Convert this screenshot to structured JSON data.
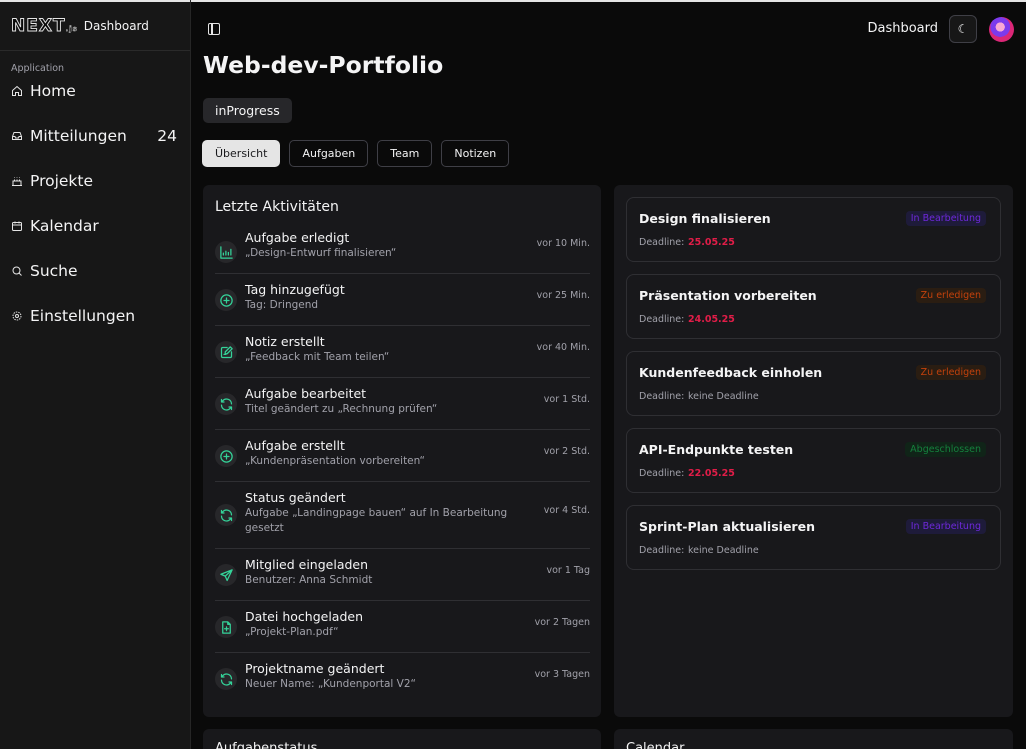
{
  "sidebar": {
    "brand_label": "Dashboard",
    "logo_text": "NEXT",
    "logo_suffix": ".js",
    "group_label": "Application",
    "items": [
      {
        "label": "Home",
        "icon": "home-icon"
      },
      {
        "label": "Mitteilungen",
        "icon": "inbox-icon",
        "count": "24"
      },
      {
        "label": "Projekte",
        "icon": "cake-icon"
      },
      {
        "label": "Kalendar",
        "icon": "calendar-icon"
      },
      {
        "label": "Suche",
        "icon": "search-icon"
      },
      {
        "label": "Einstellungen",
        "icon": "gear-icon"
      }
    ]
  },
  "header": {
    "title": "Dashboard",
    "theme_icon": "moon-icon"
  },
  "project": {
    "title": "Web-dev-Portfolio",
    "status": "inProgress"
  },
  "tabs": [
    {
      "label": "Übersicht",
      "active": true
    },
    {
      "label": "Aufgaben",
      "active": false
    },
    {
      "label": "Team",
      "active": false
    },
    {
      "label": "Notizen",
      "active": false
    }
  ],
  "activity": {
    "heading": "Letzte Aktivitäten",
    "items": [
      {
        "title": "Aufgabe erledigt",
        "desc": "„Design-Entwurf finalisieren“",
        "time": "vor 10 Min.",
        "icon": "chart-icon"
      },
      {
        "title": "Tag hinzugefügt",
        "desc": "Tag: Dringend",
        "time": "vor 25 Min.",
        "icon": "plus-circle-icon"
      },
      {
        "title": "Notiz erstellt",
        "desc": "„Feedback mit Team teilen“",
        "time": "vor 40 Min.",
        "icon": "note-edit-icon"
      },
      {
        "title": "Aufgabe bearbeitet",
        "desc": "Titel geändert zu „Rechnung prüfen“",
        "time": "vor 1 Std.",
        "icon": "refresh-icon"
      },
      {
        "title": "Aufgabe erstellt",
        "desc": "„Kundenpräsentation vorbereiten“",
        "time": "vor 2 Std.",
        "icon": "plus-circle-icon"
      },
      {
        "title": "Status geändert",
        "desc": "Aufgabe „Landingpage bauen“ auf In Bearbeitung gesetzt",
        "time": "vor 4 Std.",
        "icon": "refresh-icon"
      },
      {
        "title": "Mitglied eingeladen",
        "desc": "Benutzer: Anna Schmidt",
        "time": "vor 1 Tag",
        "icon": "send-icon"
      },
      {
        "title": "Datei hochgeladen",
        "desc": "„Projekt-Plan.pdf“",
        "time": "vor 2 Tagen",
        "icon": "file-plus-icon"
      },
      {
        "title": "Projektname geändert",
        "desc": "Neuer Name: „Kundenportal V2“",
        "time": "vor 3 Tagen",
        "icon": "refresh-icon"
      }
    ]
  },
  "tasks": {
    "deadline_label": "Deadline:",
    "items": [
      {
        "title": "Design finalisieren",
        "status": "In Bearbeitung",
        "status_type": "progress",
        "deadline": "25.05.25"
      },
      {
        "title": "Präsentation vorbereiten",
        "status": "Zu erledigen",
        "status_type": "todo",
        "deadline": "24.05.25"
      },
      {
        "title": "Kundenfeedback einholen",
        "status": "Zu erledigen",
        "status_type": "todo",
        "deadline": "keine Deadline"
      },
      {
        "title": "API-Endpunkte testen",
        "status": "Abgeschlossen",
        "status_type": "done",
        "deadline": "22.05.25"
      },
      {
        "title": "Sprint-Plan aktualisieren",
        "status": "In Bearbeitung",
        "status_type": "progress",
        "deadline": "keine Deadline"
      }
    ]
  },
  "bottom": {
    "left_heading": "Aufgabenstatus",
    "right_heading": "Calendar"
  },
  "colors": {
    "accent_green": "#34d399",
    "deadline_red": "#e11d48",
    "progress_purple": "#6d28d9",
    "todo_orange": "#c2410c",
    "done_green": "#15803d"
  }
}
